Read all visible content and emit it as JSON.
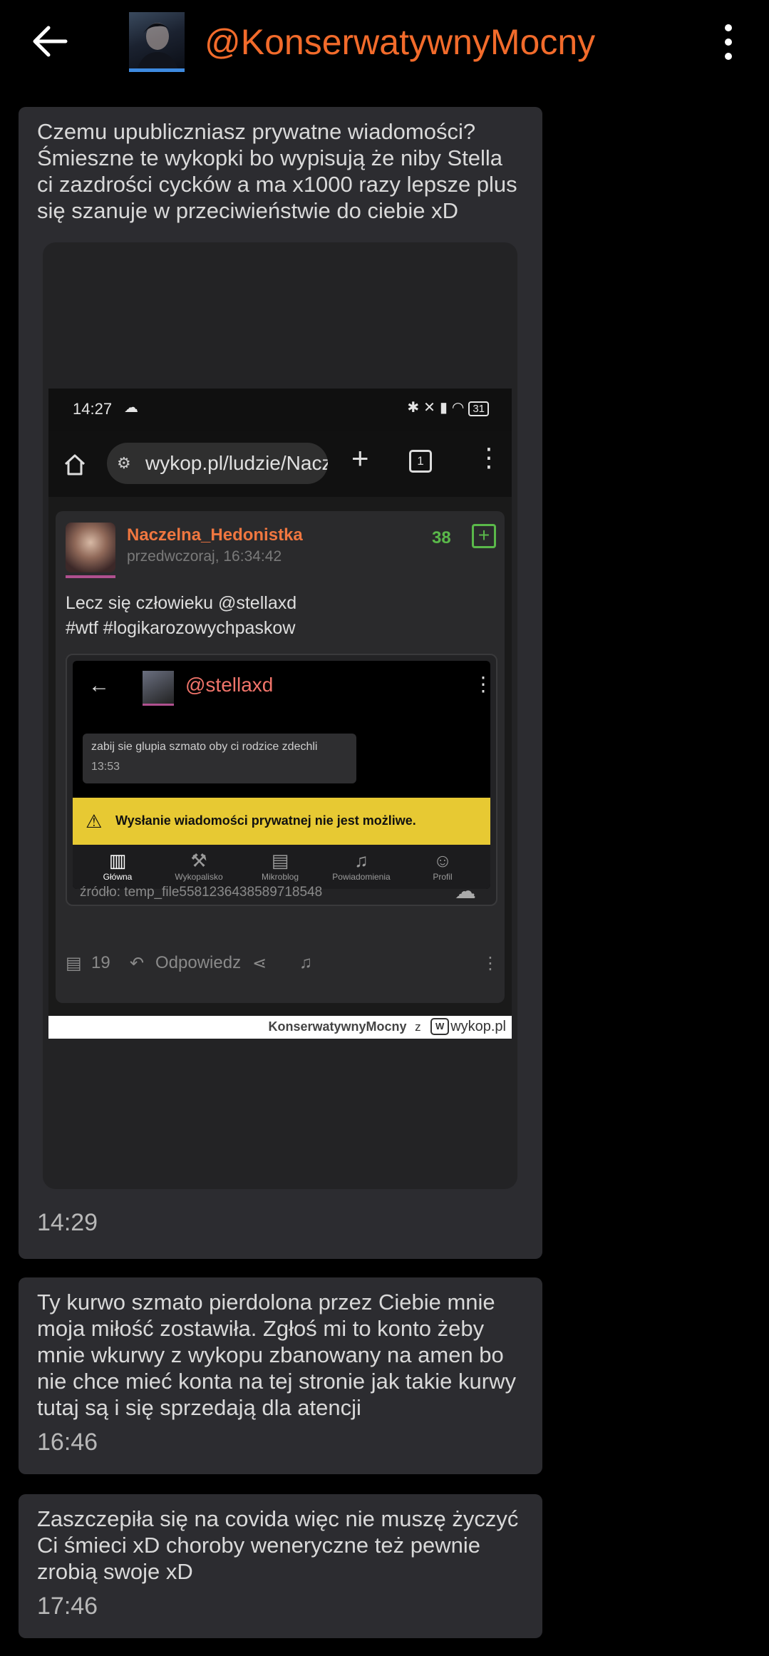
{
  "header": {
    "back_icon": "arrow-left-icon",
    "title": "@KonserwatywnyMocny",
    "menu_icon": "more-vertical-icon",
    "title_color": "#f26b2b"
  },
  "messages": [
    {
      "lines": [
        "Czemu upubliczniasz prywatne wiadomości?",
        "Śmieszne te wykopki bo wypisują że niby Stella",
        "ci zazdrości cycków a ma x1000 razy lepsze plus",
        "się szanuje w przeciwieństwie do ciebie xD"
      ],
      "time": "14:29",
      "attachment": {
        "status_time": "14:27",
        "status_battery": "31",
        "url": "wykop.pl/ludzie/Naczelna_Hedonistka",
        "tabs_count": "1",
        "post": {
          "author": "Naczelna_Hedonistka",
          "date": "przedwczoraj, 16:34:42",
          "score": "38",
          "body_line1": "Lecz się człowieku @stellaxd",
          "body_line2": "#wtf #logikarozowychpaskow",
          "inner": {
            "chat_name": "@stellaxd",
            "message": "zabij sie glupia szmato oby ci rodzice zdechli",
            "message_time": "13:53",
            "warning": "Wysłanie wiadomości prywatnej nie jest możliwe.",
            "nav": [
              "Główna",
              "Wykopalisko",
              "Mikroblog",
              "Powiadomienia",
              "Profil"
            ],
            "source": "źródło: temp_file5581236438589718548"
          },
          "comments_count": "19",
          "reply_label": "Odpowiedz"
        },
        "watermark_user": "KonserwatywnyMocny",
        "watermark_z": "z",
        "watermark_site": "wykop.pl"
      }
    },
    {
      "lines": [
        "Ty kurwo szmato pierdolona przez Ciebie mnie",
        "moja miłość zostawiła. Zgłoś mi to konto żeby",
        "mnie wkurwy z wykopu zbanowany na amen bo",
        "nie chce mieć konta na tej stronie jak takie kurwy",
        "tutaj są i się sprzedają dla atencji"
      ],
      "time": "16:46"
    },
    {
      "lines": [
        "Zaszczepiła się na covida więc nie muszę życzyć",
        "Ci śmieci xD choroby weneryczne też pewnie",
        "zrobią swoje xD"
      ],
      "time": "17:46"
    }
  ]
}
